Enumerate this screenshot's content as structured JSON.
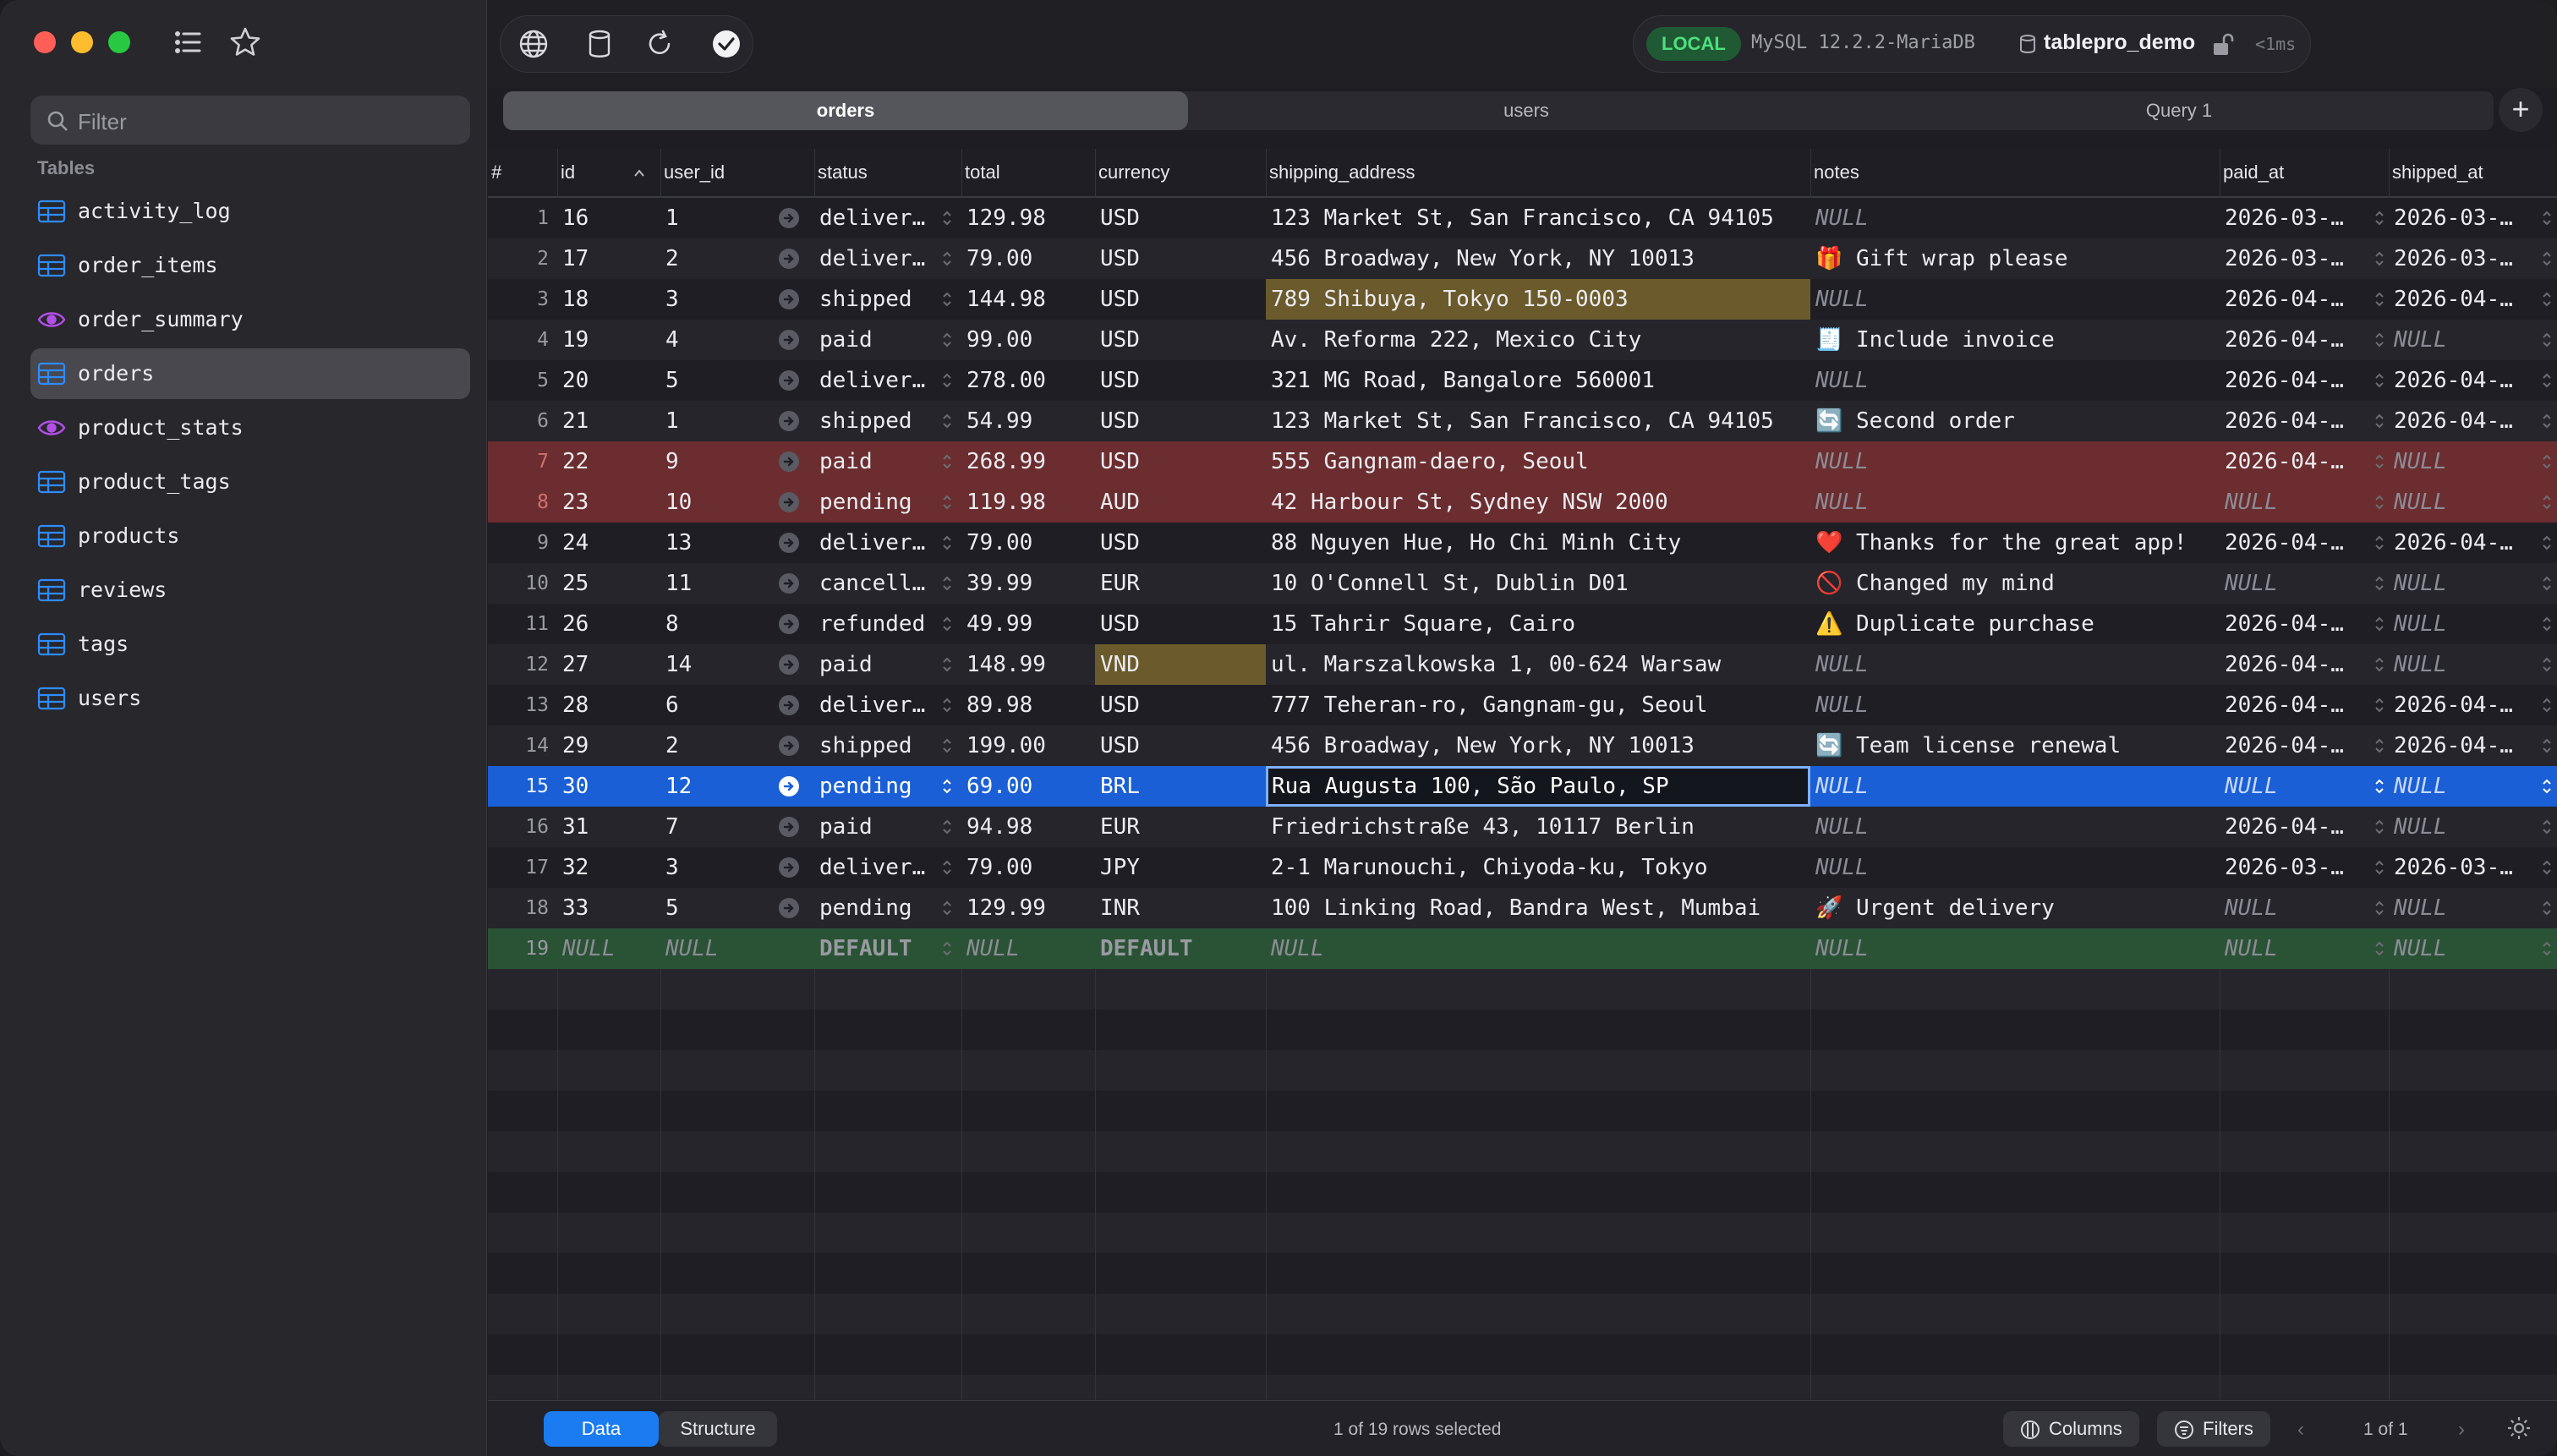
{
  "sidebar": {
    "filter_placeholder": "Filter",
    "section_label": "Tables",
    "items": [
      {
        "name": "activity_log",
        "kind": "table"
      },
      {
        "name": "order_items",
        "kind": "table"
      },
      {
        "name": "order_summary",
        "kind": "view"
      },
      {
        "name": "orders",
        "kind": "table"
      },
      {
        "name": "product_stats",
        "kind": "view"
      },
      {
        "name": "product_tags",
        "kind": "table"
      },
      {
        "name": "products",
        "kind": "table"
      },
      {
        "name": "reviews",
        "kind": "table"
      },
      {
        "name": "tags",
        "kind": "table"
      },
      {
        "name": "users",
        "kind": "table"
      }
    ],
    "selected": "orders"
  },
  "toolbar": {
    "env_badge": "LOCAL",
    "server": "MySQL 12.2.2-MariaDB",
    "database": "tablepro_demo",
    "latency": "<1ms"
  },
  "tabs": [
    {
      "label": "orders",
      "active": true
    },
    {
      "label": "users",
      "active": false
    },
    {
      "label": "Query 1",
      "active": false
    }
  ],
  "grid": {
    "columns": [
      "#",
      "id",
      "user_id",
      "status",
      "total",
      "currency",
      "shipping_address",
      "notes",
      "paid_at",
      "shipped_at"
    ],
    "rows": [
      {
        "n": "1",
        "id": "16",
        "user_id": "1",
        "status": "deliver…",
        "total": "129.98",
        "currency": "USD",
        "address": "123 Market St, San Francisco, CA 94105",
        "notes": "NULL",
        "paid_at": "2026-03-…",
        "shipped_at": "2026-03-…"
      },
      {
        "n": "2",
        "id": "17",
        "user_id": "2",
        "status": "deliver…",
        "total": "79.00",
        "currency": "USD",
        "address": "456 Broadway, New York, NY 10013",
        "notes": "🎁 Gift wrap please",
        "paid_at": "2026-03-…",
        "shipped_at": "2026-03-…"
      },
      {
        "n": "3",
        "id": "18",
        "user_id": "3",
        "status": "shipped",
        "total": "144.98",
        "currency": "USD",
        "address": "789 Shibuya, Tokyo 150-0003",
        "notes": "NULL",
        "paid_at": "2026-04-…",
        "shipped_at": "2026-04-…",
        "hl": "address"
      },
      {
        "n": "4",
        "id": "19",
        "user_id": "4",
        "status": "paid",
        "total": "99.00",
        "currency": "USD",
        "address": "Av. Reforma 222, Mexico City",
        "notes": "🧾 Include invoice",
        "paid_at": "2026-04-…",
        "shipped_at": "NULL"
      },
      {
        "n": "5",
        "id": "20",
        "user_id": "5",
        "status": "deliver…",
        "total": "278.00",
        "currency": "USD",
        "address": "321 MG Road, Bangalore 560001",
        "notes": "NULL",
        "paid_at": "2026-04-…",
        "shipped_at": "2026-04-…"
      },
      {
        "n": "6",
        "id": "21",
        "user_id": "1",
        "status": "shipped",
        "total": "54.99",
        "currency": "USD",
        "address": "123 Market St, San Francisco, CA 94105",
        "notes": "🔄 Second order",
        "paid_at": "2026-04-…",
        "shipped_at": "2026-04-…"
      },
      {
        "n": "7",
        "id": "22",
        "user_id": "9",
        "status": "paid",
        "total": "268.99",
        "currency": "USD",
        "address": "555 Gangnam-daero, Seoul",
        "notes": "NULL",
        "paid_at": "2026-04-…",
        "shipped_at": "NULL",
        "state": "deleted"
      },
      {
        "n": "8",
        "id": "23",
        "user_id": "10",
        "status": "pending",
        "total": "119.98",
        "currency": "AUD",
        "address": "42 Harbour St, Sydney NSW 2000",
        "notes": "NULL",
        "paid_at": "NULL",
        "shipped_at": "NULL",
        "state": "deleted"
      },
      {
        "n": "9",
        "id": "24",
        "user_id": "13",
        "status": "deliver…",
        "total": "79.00",
        "currency": "USD",
        "address": "88 Nguyen Hue, Ho Chi Minh City",
        "notes": "❤️ Thanks for the great app!",
        "paid_at": "2026-04-…",
        "shipped_at": "2026-04-…"
      },
      {
        "n": "10",
        "id": "25",
        "user_id": "11",
        "status": "cancell…",
        "total": "39.99",
        "currency": "EUR",
        "address": "10 O'Connell St, Dublin D01",
        "notes": "🚫 Changed my mind",
        "paid_at": "NULL",
        "shipped_at": "NULL"
      },
      {
        "n": "11",
        "id": "26",
        "user_id": "8",
        "status": "refunded",
        "total": "49.99",
        "currency": "USD",
        "address": "15 Tahrir Square, Cairo",
        "notes": "⚠️ Duplicate purchase",
        "paid_at": "2026-04-…",
        "shipped_at": "NULL"
      },
      {
        "n": "12",
        "id": "27",
        "user_id": "14",
        "status": "paid",
        "total": "148.99",
        "currency": "VND",
        "address": "ul. Marszalkowska 1, 00-624 Warsaw",
        "notes": "NULL",
        "paid_at": "2026-04-…",
        "shipped_at": "NULL",
        "hl": "currency"
      },
      {
        "n": "13",
        "id": "28",
        "user_id": "6",
        "status": "deliver…",
        "total": "89.98",
        "currency": "USD",
        "address": "777 Teheran-ro, Gangnam-gu, Seoul",
        "notes": "NULL",
        "paid_at": "2026-04-…",
        "shipped_at": "2026-04-…"
      },
      {
        "n": "14",
        "id": "29",
        "user_id": "2",
        "status": "shipped",
        "total": "199.00",
        "currency": "USD",
        "address": "456 Broadway, New York, NY 10013",
        "notes": "🔄 Team license renewal",
        "paid_at": "2026-04-…",
        "shipped_at": "2026-04-…"
      },
      {
        "n": "15",
        "id": "30",
        "user_id": "12",
        "status": "pending",
        "total": "69.00",
        "currency": "BRL",
        "address": "Rua Augusta 100, São Paulo, SP",
        "notes": "NULL",
        "paid_at": "NULL",
        "shipped_at": "NULL",
        "state": "selected"
      },
      {
        "n": "16",
        "id": "31",
        "user_id": "7",
        "status": "paid",
        "total": "94.98",
        "currency": "EUR",
        "address": "Friedrichstraße 43, 10117 Berlin",
        "notes": "NULL",
        "paid_at": "2026-04-…",
        "shipped_at": "NULL"
      },
      {
        "n": "17",
        "id": "32",
        "user_id": "3",
        "status": "deliver…",
        "total": "79.00",
        "currency": "JPY",
        "address": "2-1 Marunouchi, Chiyoda-ku, Tokyo",
        "notes": "NULL",
        "paid_at": "2026-03-…",
        "shipped_at": "2026-03-…"
      },
      {
        "n": "18",
        "id": "33",
        "user_id": "5",
        "status": "pending",
        "total": "129.99",
        "currency": "INR",
        "address": "100 Linking Road, Bandra West, Mumbai",
        "notes": "🚀 Urgent delivery",
        "paid_at": "NULL",
        "shipped_at": "NULL"
      },
      {
        "n": "19",
        "id": "NULL",
        "user_id": "NULL",
        "status": "DEFAULT",
        "total": "NULL",
        "currency": "DEFAULT",
        "address": "NULL",
        "notes": "NULL",
        "paid_at": "NULL",
        "shipped_at": "NULL",
        "state": "inserted"
      }
    ]
  },
  "bottom": {
    "data_label": "Data",
    "structure_label": "Structure",
    "status": "1 of 19 rows selected",
    "columns_label": "Columns",
    "filters_label": "Filters",
    "page": "1 of 1"
  },
  "colors": {
    "selected_row": "#1a5fd6",
    "deleted_row": "#6b2d2f",
    "inserted_row": "#2a5335",
    "modified_cell": "#6b5a2c",
    "sidebar_table_icon": "#2f8cff",
    "sidebar_view_icon": "#b34ee8"
  }
}
